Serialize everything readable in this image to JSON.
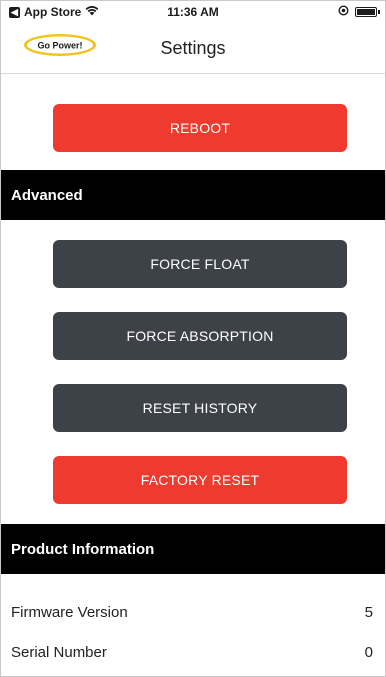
{
  "status_bar": {
    "back_app": "App Store",
    "time": "11:36 AM",
    "back_glyph": "◀",
    "icons": [
      "wifi-icon",
      "location-icon",
      "battery-icon"
    ]
  },
  "nav": {
    "logo_text": "Go Power!",
    "title": "Settings"
  },
  "top_actions": {
    "reboot_label": "REBOOT"
  },
  "advanced": {
    "header": "Advanced",
    "force_float_label": "FORCE FLOAT",
    "force_absorption_label": "FORCE ABSORPTION",
    "reset_history_label": "RESET HISTORY",
    "factory_reset_label": "FACTORY RESET"
  },
  "product_info": {
    "header": "Product Information",
    "rows": [
      {
        "label": "Firmware Version",
        "value": "5"
      },
      {
        "label": "Serial Number",
        "value": "0"
      }
    ]
  },
  "colors": {
    "danger": "#ef3a2f",
    "dark_button": "#3d4249",
    "section_bg": "#000000"
  }
}
